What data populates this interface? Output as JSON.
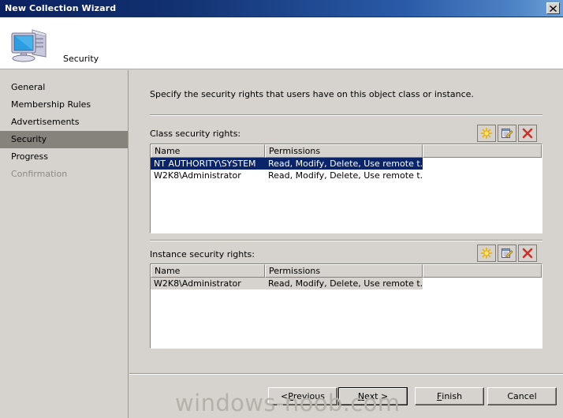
{
  "window": {
    "title": "New Collection Wizard",
    "close_label": "×",
    "close_icon": "close-icon"
  },
  "header": {
    "title": "Security",
    "icon": "computer-icon"
  },
  "sidebar": {
    "items": [
      {
        "label": "General",
        "state": "normal"
      },
      {
        "label": "Membership Rules",
        "state": "normal"
      },
      {
        "label": "Advertisements",
        "state": "normal"
      },
      {
        "label": "Security",
        "state": "current"
      },
      {
        "label": "Progress",
        "state": "normal"
      },
      {
        "label": "Confirmation",
        "state": "disabled"
      }
    ]
  },
  "main": {
    "description": "Specify the security rights that users have on this object class or instance.",
    "class_section": {
      "label": "Class security rights:",
      "toolbar": [
        {
          "name": "new-icon",
          "tooltip": "New"
        },
        {
          "name": "properties-icon",
          "tooltip": "Properties"
        },
        {
          "name": "delete-icon",
          "tooltip": "Delete"
        }
      ],
      "columns": [
        "Name",
        "Permissions",
        ""
      ],
      "rows": [
        {
          "name": "NT AUTHORITY\\SYSTEM",
          "permissions": "Read, Modify, Delete, Use remote t...",
          "selection": "active"
        },
        {
          "name": "W2K8\\Administrator",
          "permissions": "Read, Modify, Delete, Use remote t...",
          "selection": "none"
        }
      ]
    },
    "instance_section": {
      "label": "Instance security rights:",
      "toolbar": [
        {
          "name": "new-icon",
          "tooltip": "New"
        },
        {
          "name": "properties-icon",
          "tooltip": "Properties"
        },
        {
          "name": "delete-icon",
          "tooltip": "Delete"
        }
      ],
      "columns": [
        "Name",
        "Permissions",
        ""
      ],
      "rows": [
        {
          "name": "W2K8\\Administrator",
          "permissions": "Read, Modify, Delete, Use remote t...",
          "selection": "inactive"
        }
      ]
    }
  },
  "footer": {
    "buttons": [
      {
        "id": "previous",
        "prefix": "< ",
        "mnemonic": "P",
        "suffix": "revious",
        "default": false
      },
      {
        "id": "next",
        "prefix": "",
        "mnemonic": "N",
        "suffix": "ext >",
        "default": true
      },
      {
        "id": "finish",
        "prefix": "",
        "mnemonic": "F",
        "suffix": "inish",
        "default": false
      },
      {
        "id": "cancel",
        "prefix": "Cancel",
        "mnemonic": "",
        "suffix": "",
        "default": false
      }
    ]
  },
  "watermark": {
    "text": "windows-noob.com"
  },
  "colors": {
    "titlebar_start": "#0b2161",
    "titlebar_end": "#6fa2d8",
    "dialog_face": "#d6d3ce",
    "selection_active": "#0a246a",
    "selection_inactive": "#d6d3ce",
    "nav_current": "#86827c",
    "delete_red": "#c8322a",
    "new_yellow": "#f5d23c"
  }
}
